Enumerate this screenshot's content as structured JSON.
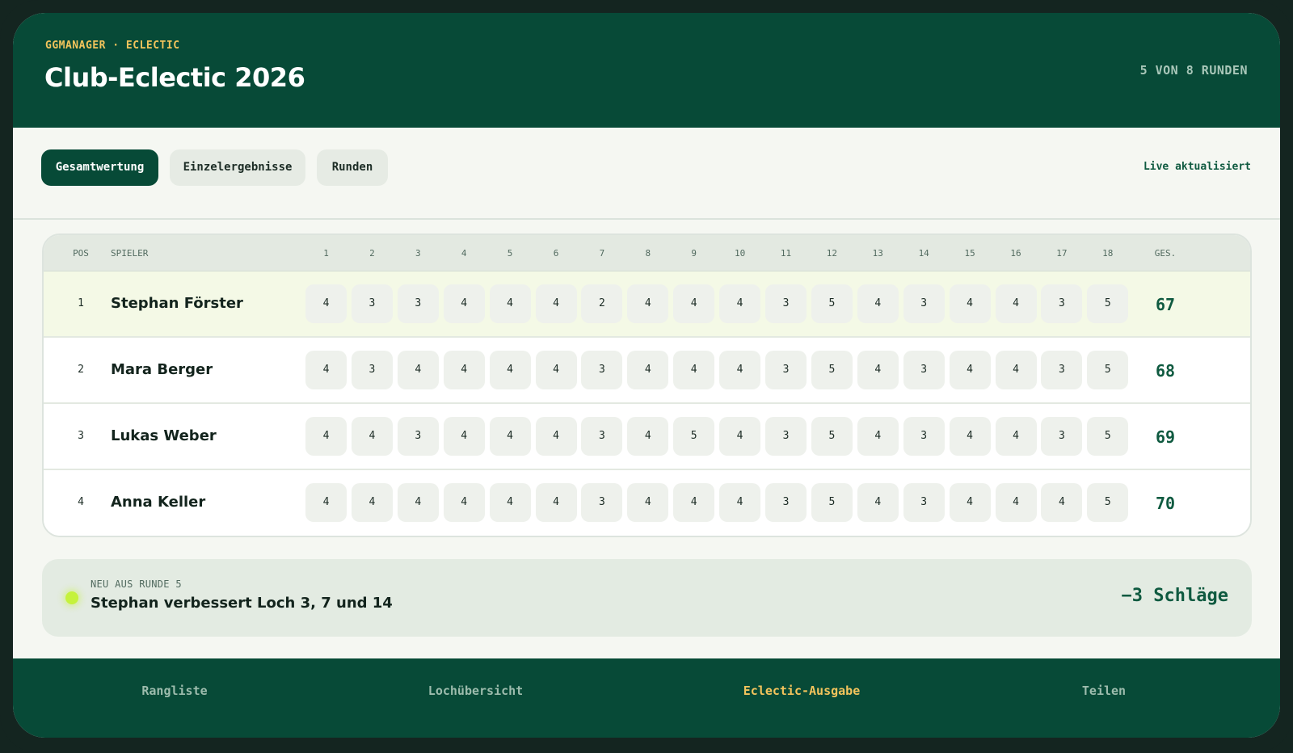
{
  "header": {
    "brand": "GGMANAGER · ECLECTIC",
    "title": "Club-Eclectic 2026",
    "rounds_status": "5 VON 8 RUNDEN"
  },
  "tabs": [
    {
      "label": "Gesamtwertung",
      "active": true
    },
    {
      "label": "Einzelergebnisse",
      "active": false
    },
    {
      "label": "Runden",
      "active": false
    }
  ],
  "live_status": "Live aktualisiert",
  "table": {
    "col_pos": "POS",
    "col_player": "SPIELER",
    "holes": [
      "1",
      "2",
      "3",
      "4",
      "5",
      "6",
      "7",
      "8",
      "9",
      "10",
      "11",
      "12",
      "13",
      "14",
      "15",
      "16",
      "17",
      "18"
    ],
    "col_total": "GES.",
    "rows": [
      {
        "pos": "1",
        "name": "Stephan Förster",
        "scores": [
          "4",
          "3",
          "3",
          "4",
          "4",
          "4",
          "2",
          "4",
          "4",
          "4",
          "3",
          "5",
          "4",
          "3",
          "4",
          "4",
          "3",
          "5"
        ],
        "total": "67"
      },
      {
        "pos": "2",
        "name": "Mara Berger",
        "scores": [
          "4",
          "3",
          "4",
          "4",
          "4",
          "4",
          "3",
          "4",
          "4",
          "4",
          "3",
          "5",
          "4",
          "3",
          "4",
          "4",
          "3",
          "5"
        ],
        "total": "68"
      },
      {
        "pos": "3",
        "name": "Lukas Weber",
        "scores": [
          "4",
          "4",
          "3",
          "4",
          "4",
          "4",
          "3",
          "4",
          "5",
          "4",
          "3",
          "5",
          "4",
          "3",
          "4",
          "4",
          "3",
          "5"
        ],
        "total": "69"
      },
      {
        "pos": "4",
        "name": "Anna Keller",
        "scores": [
          "4",
          "4",
          "4",
          "4",
          "4",
          "4",
          "3",
          "4",
          "4",
          "4",
          "3",
          "5",
          "4",
          "3",
          "4",
          "4",
          "4",
          "5"
        ],
        "total": "70"
      }
    ]
  },
  "news": {
    "tag": "NEU AUS RUNDE 5",
    "text": "Stephan verbessert Loch 3, 7 und 14",
    "delta": "−3 Schläge"
  },
  "nav": [
    {
      "label": "Rangliste",
      "active": false
    },
    {
      "label": "Lochübersicht",
      "active": false
    },
    {
      "label": "Eclectic-Ausgabe",
      "active": true
    },
    {
      "label": "Teilen",
      "active": false
    }
  ],
  "colors": {
    "brand_green": "#074a37",
    "accent_yellow": "#f3c45c",
    "live_dot": "#c5f23c"
  }
}
